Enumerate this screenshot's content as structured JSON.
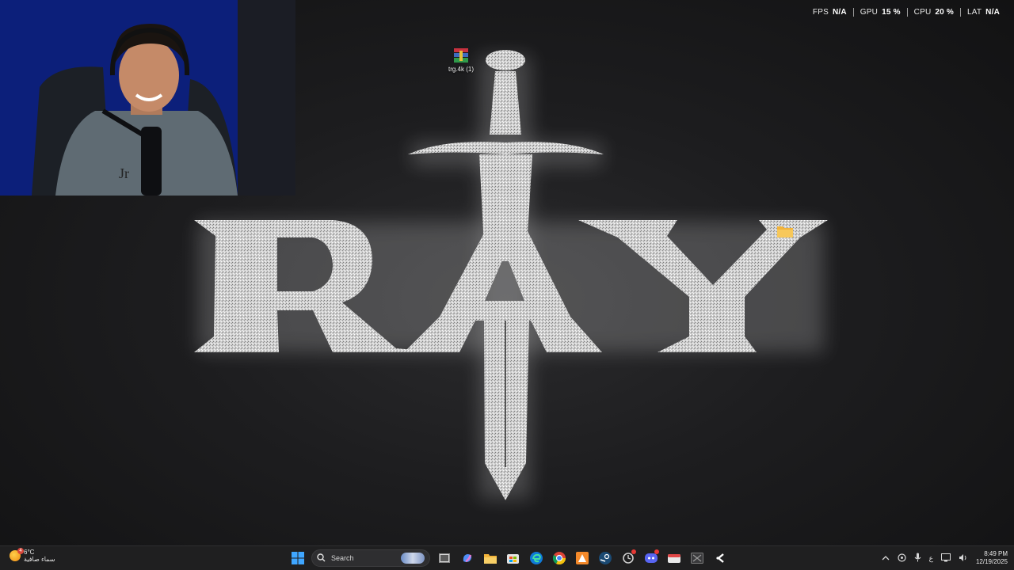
{
  "perf_overlay": {
    "fps": {
      "label": "FPS",
      "value": "N/A"
    },
    "gpu": {
      "label": "GPU",
      "value": "15 %"
    },
    "cpu": {
      "label": "CPU",
      "value": "20 %"
    },
    "lat": {
      "label": "LAT",
      "value": "N/A"
    }
  },
  "wallpaper": {
    "logo_text": "RAY",
    "colors": {
      "background": "#1a1a1b",
      "logo": "#d9d9d9"
    }
  },
  "desktop_icons": [
    {
      "label": "trg.4k (1)",
      "icon": "winrar-archive-icon"
    },
    {
      "label": "",
      "icon": "folder-icon"
    }
  ],
  "webcam": {
    "icon": "streamer-webcam"
  },
  "taskbar": {
    "weather": {
      "temp": "6°C",
      "condition": "سماء صافية",
      "badge": "4"
    },
    "search": {
      "placeholder": "Search"
    },
    "apps": [
      {
        "name": "start",
        "icon": "windows-start-icon"
      },
      {
        "name": "task-view",
        "icon": "task-view-icon"
      },
      {
        "name": "copilot",
        "icon": "copilot-icon"
      },
      {
        "name": "file-explorer",
        "icon": "folder-icon"
      },
      {
        "name": "store",
        "icon": "store-icon"
      },
      {
        "name": "edge",
        "icon": "edge-icon"
      },
      {
        "name": "chrome",
        "icon": "chrome-icon"
      },
      {
        "name": "app-a",
        "icon": "triangle-app-icon"
      },
      {
        "name": "steam",
        "icon": "steam-icon"
      },
      {
        "name": "app-clock",
        "icon": "refresh-app-icon"
      },
      {
        "name": "discord",
        "icon": "discord-icon"
      },
      {
        "name": "app-red",
        "icon": "red-app-icon"
      },
      {
        "name": "app-x",
        "icon": "box-app-icon"
      },
      {
        "name": "app-g",
        "icon": "gamepad-app-icon"
      }
    ],
    "tray": {
      "language": "ع",
      "time": "8:49 PM",
      "date": "12/19/2025"
    }
  }
}
